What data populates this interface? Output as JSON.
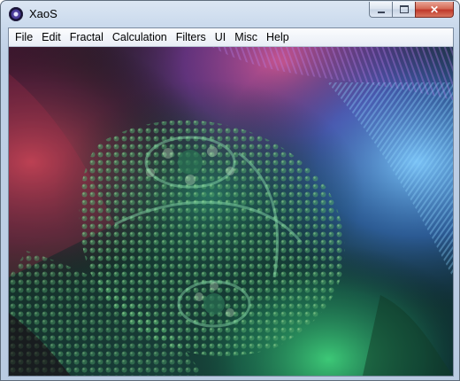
{
  "window": {
    "title": "XaoS",
    "icon": "xaos-app-icon",
    "buttons": [
      "minimize",
      "maximize",
      "close"
    ]
  },
  "menu": [
    {
      "label": "File"
    },
    {
      "label": "Edit"
    },
    {
      "label": "Fractal"
    },
    {
      "label": "Calculation"
    },
    {
      "label": "Filters"
    },
    {
      "label": "UI"
    },
    {
      "label": "Misc"
    },
    {
      "label": "Help"
    }
  ],
  "canvas": {
    "content": "fractal-render",
    "palette": [
      "#1a5c3a",
      "#3b7d4a",
      "#2a8a8c",
      "#5fb6d8",
      "#8a3a78",
      "#c2486a",
      "#7e5bd3",
      "#0b1a14"
    ]
  }
}
